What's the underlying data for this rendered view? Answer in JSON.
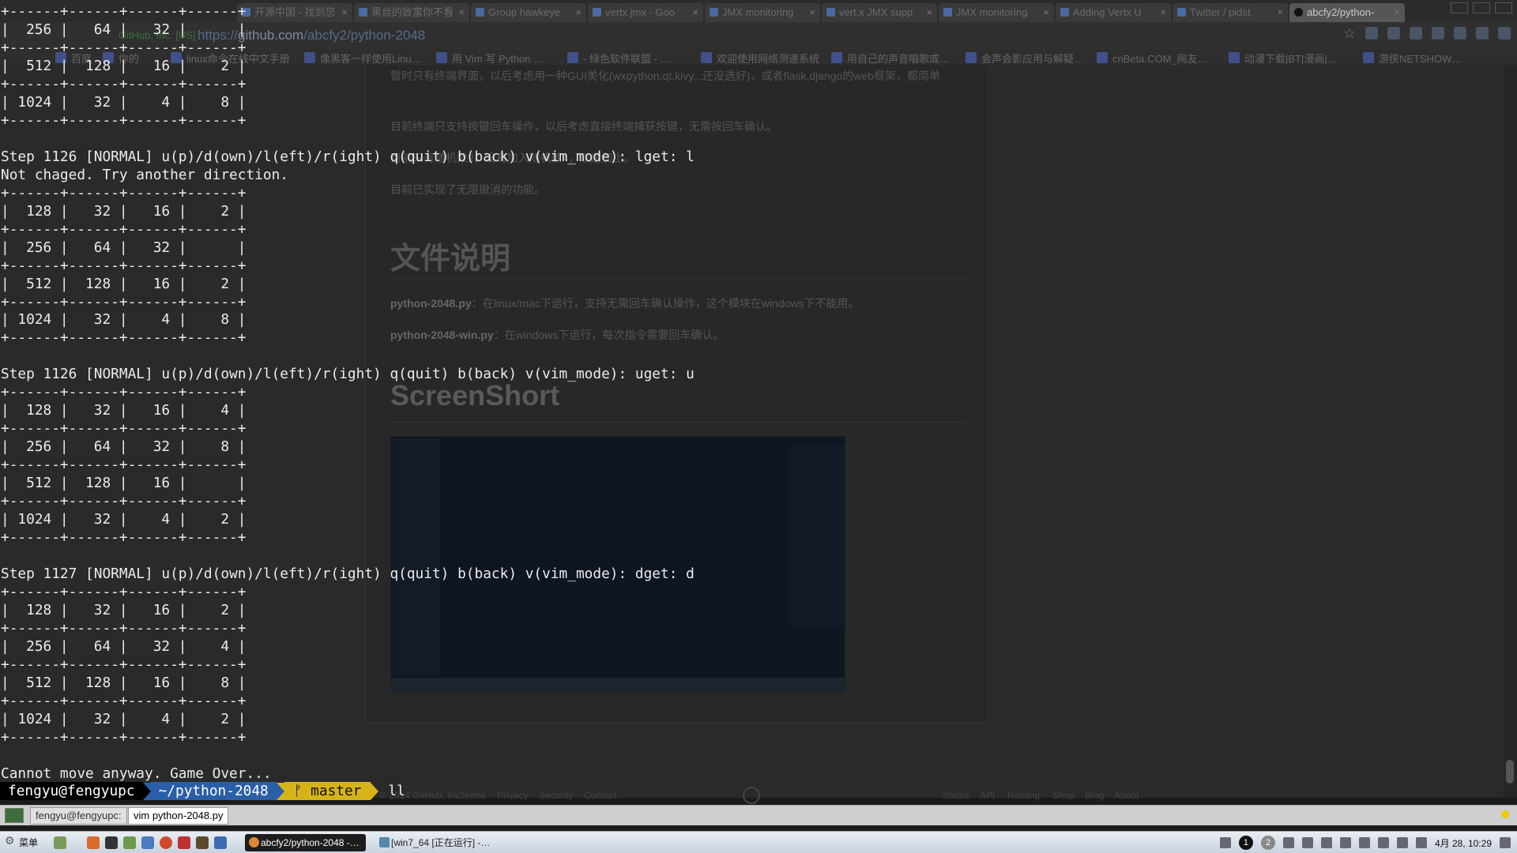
{
  "browser": {
    "tabs": [
      {
        "label": "开源中国 - 找到您"
      },
      {
        "label": "黑丝的致富你不看"
      },
      {
        "label": "Group hawkeye"
      },
      {
        "label": "vertx jmx - Goo"
      },
      {
        "label": "JMX monitoring"
      },
      {
        "label": "vert.x JMX supp"
      },
      {
        "label": "JMX monitoring"
      },
      {
        "label": "Adding Vertx U"
      },
      {
        "label": "Twitter / pidst"
      },
      {
        "label": "abcfy2/python-"
      }
    ],
    "tab_close": "×",
    "url": {
      "secure_label": "GitHub, Inc. [US]",
      "scheme": "https://",
      "host": "github.com",
      "path": "/abcfy2/python-2048"
    },
    "star": "☆",
    "bookmarks": [
      "百度",
      "你的",
      "linux命令在线中文手册",
      "像黑客一样使用Linu…",
      "用 Vim 写 Python …",
      "- 绿色软件联盟 - …",
      "欢迎使用网络测速系统",
      "用自己的声音唱歌或…",
      "会声会影应用与解疑…",
      "cnBeta.COM_网友…",
      "动漫下载|BT|漫画|…",
      "游侠NETSHOW…"
    ]
  },
  "readme": {
    "p1": "暂时只有终端界面，以后考虑用一种GUI美化(wxpython,qt,kivy...还没选好)，或者flask,django的web框架，都简单",
    "p2": "目前终端只支持按键回车操作，以后考虑直接终端捕获按键，无需按回车确认。",
    "p3": "目前只有随机数2，没有加入随机数4，以后加上。",
    "p4": "目前已实现了无限撤消的功能。",
    "h_files": "文件说明",
    "f1_name": "python-2048.py",
    "f1_desc": "：在linux/mac下运行，支持无需回车确认操作，这个模块在windows下不能用。",
    "f2_name": "python-2048-win.py",
    "f2_desc": "：在windows下运行，每次指令需要回车确认。",
    "h_shot": "ScreenShort"
  },
  "footer": {
    "copyright": "© 2014 GitHub, Inc.",
    "left_links": [
      "Terms",
      "Privacy",
      "Security",
      "Contact"
    ],
    "right_links": [
      "Status",
      "API",
      "Training",
      "Shop",
      "Blog",
      "About"
    ]
  },
  "terminal": {
    "lines": [
      "+------+------+------+------+",
      "|  256 |   64 |   32 |      |",
      "+------+------+------+------+",
      "|  512 |  128 |   16 |    2 |",
      "+------+------+------+------+",
      "| 1024 |   32 |    4 |    8 |",
      "+------+------+------+------+",
      "",
      "Step 1126 [NORMAL] u(p)/d(own)/l(eft)/r(ight) q(quit) b(back) v(vim_mode): lget: l",
      "Not chaged. Try another direction.",
      "+------+------+------+------+",
      "|  128 |   32 |   16 |    2 |",
      "+------+------+------+------+",
      "|  256 |   64 |   32 |      |",
      "+------+------+------+------+",
      "|  512 |  128 |   16 |    2 |",
      "+------+------+------+------+",
      "| 1024 |   32 |    4 |    8 |",
      "+------+------+------+------+",
      "",
      "Step 1126 [NORMAL] u(p)/d(own)/l(eft)/r(ight) q(quit) b(back) v(vim_mode): uget: u",
      "+------+------+------+------+",
      "|  128 |   32 |   16 |    4 |",
      "+------+------+------+------+",
      "|  256 |   64 |   32 |    8 |",
      "+------+------+------+------+",
      "|  512 |  128 |   16 |      |",
      "+------+------+------+------+",
      "| 1024 |   32 |    4 |    2 |",
      "+------+------+------+------+",
      "",
      "Step 1127 [NORMAL] u(p)/d(own)/l(eft)/r(ight) q(quit) b(back) v(vim_mode): dget: d",
      "+------+------+------+------+",
      "|  128 |   32 |   16 |    2 |",
      "+------+------+------+------+",
      "|  256 |   64 |   32 |    4 |",
      "+------+------+------+------+",
      "|  512 |  128 |   16 |    8 |",
      "+------+------+------+------+",
      "| 1024 |   32 |    4 |    2 |",
      "+------+------+------+------+",
      "",
      "Cannot move anyway. Game Over..."
    ],
    "prompt": {
      "user": "fengyu@fengyupc",
      "path": "~/python-2048",
      "branch_icon": "ᚠ",
      "branch": "master",
      "typed": "ll"
    }
  },
  "termtabs": {
    "tab1": "fengyu@fengyupc:",
    "tab2": "vim python-2048.py"
  },
  "taskbar": {
    "start": "菜单",
    "windows": [
      {
        "label": "abcfy2/python-2048 -…"
      },
      {
        "label": "[win7_64 [正在运行] -…"
      }
    ],
    "workspaces": [
      "1",
      "2"
    ],
    "clock": "4月 28, 10:29"
  }
}
